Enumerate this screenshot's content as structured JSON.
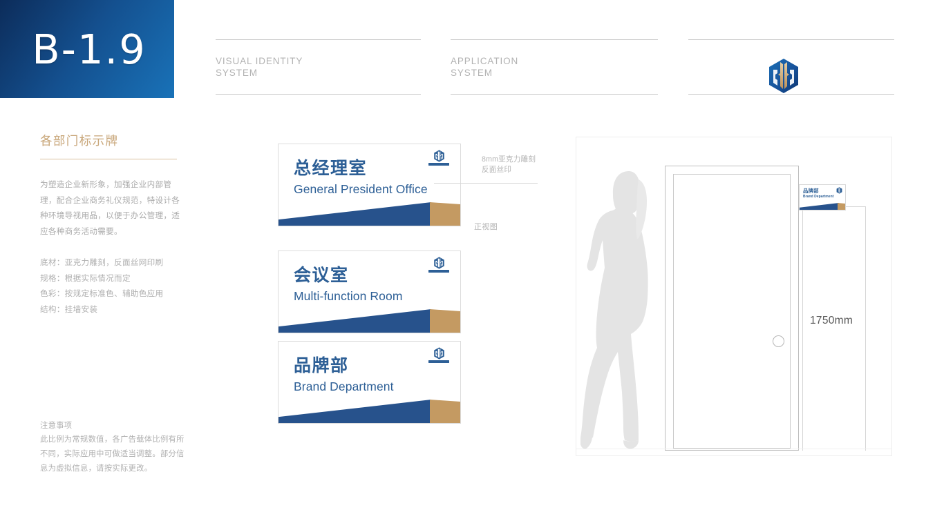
{
  "header": {
    "code": "B-1.9",
    "columns": [
      {
        "line1": "VISUAL IDENTITY",
        "line2": "SYSTEM"
      },
      {
        "line1": "APPLICATION",
        "line2": "SYSTEM"
      }
    ],
    "logo_icon": "company-hexagon-logo-icon"
  },
  "sidebar": {
    "title": "各部门标示牌",
    "description": "为塑造企业新形象，加强企业内部管理，配合企业商务礼仪规范，特设计各种环境导视用品，以便于办公管理，适应各种商务活动需要。",
    "specs": [
      "底材：亚克力雕刻，反面丝网印刷",
      "规格：根据实际情况而定",
      "色彩：按规定标准色、辅助色应用",
      "结构：挂墙安装"
    ],
    "note_title": "注意事项",
    "note_body": "此比例为常规数值，各广告载体比例有所不同，实际应用中可做适当调整。部分信息为虚拟信息，请按实际更改。"
  },
  "signs": [
    {
      "cn": "总经理室",
      "en": "General President Office"
    },
    {
      "cn": "会议室",
      "en": "Multi-function Room"
    },
    {
      "cn": "品牌部",
      "en": "Brand Department"
    }
  ],
  "callouts": {
    "material": "8mm亚克力雕刻\n反面丝印",
    "material_line1": "8mm亚克力雕刻",
    "material_line2": "反面丝印",
    "front_view": "正视图"
  },
  "mockup": {
    "dimension": "1750mm",
    "mini_sign": {
      "cn": "品牌部",
      "en": "Brand Department"
    }
  },
  "colors": {
    "brand_blue": "#27528c",
    "text_blue": "#2d5f96",
    "gold": "#c8a679",
    "tan": "#c49a62",
    "header_gradient_start": "#0c2c5a",
    "header_gradient_end": "#1972b8",
    "muted_gray": "#b2b2b2"
  }
}
